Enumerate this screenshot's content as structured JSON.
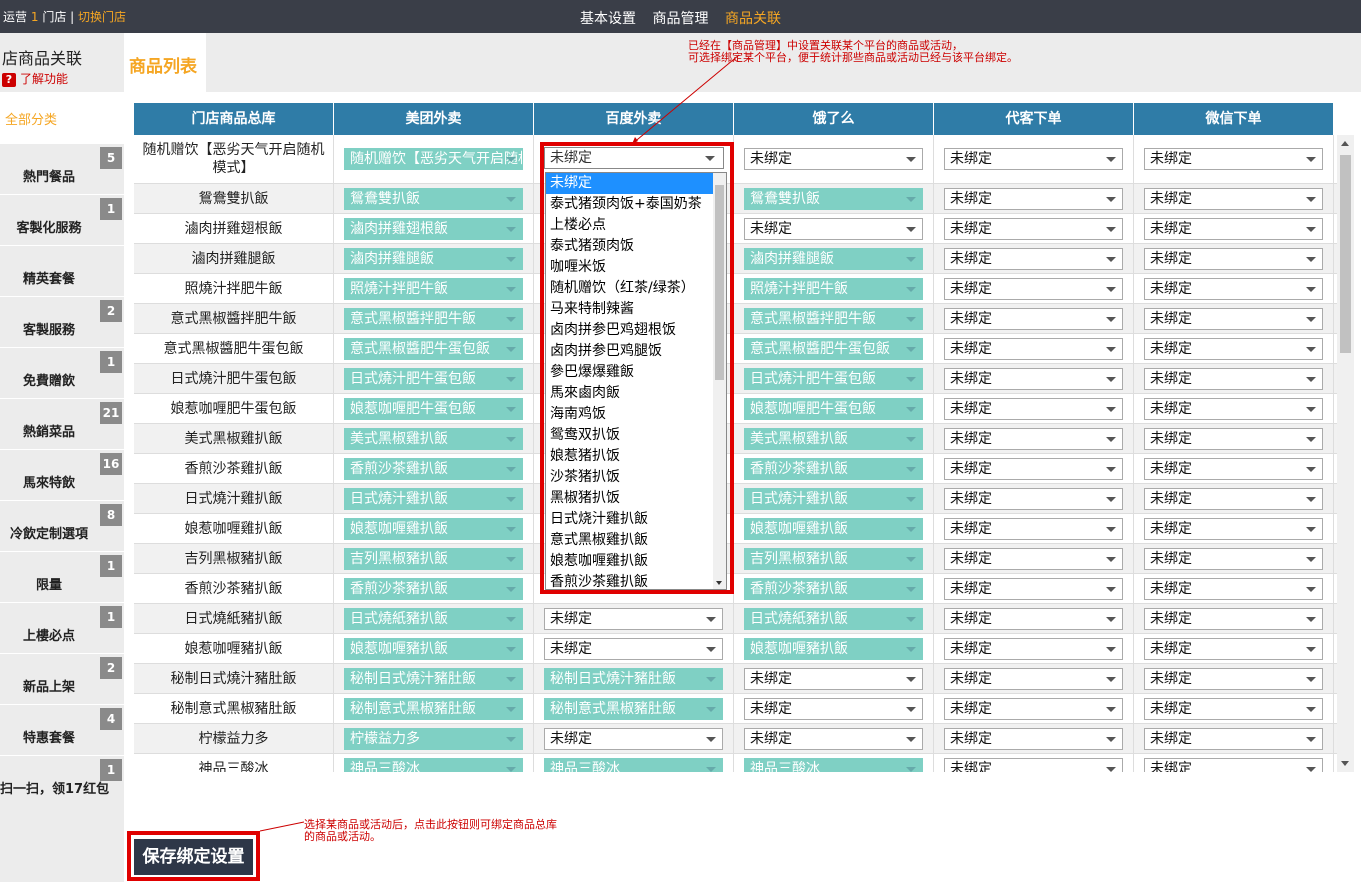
{
  "topbar": {
    "store_prefix": "运营",
    "store_count": "1",
    "store_suffix": "门店 |",
    "switch_label": "切换门店",
    "nav": [
      "基本设置",
      "商品管理",
      "商品关联"
    ],
    "active_nav": "商品关联"
  },
  "sidebar": {
    "title": "店商品关联",
    "help": "了解功能",
    "all_label": "全部分类",
    "items": [
      {
        "label": "熱門餐品",
        "count": "5"
      },
      {
        "label": "客製化服務",
        "count": "1"
      },
      {
        "label": "精英套餐",
        "count": ""
      },
      {
        "label": "客製服務",
        "count": "2"
      },
      {
        "label": "免費贈飲",
        "count": "1"
      },
      {
        "label": "熱銷菜品",
        "count": "21"
      },
      {
        "label": "馬來特飲",
        "count": "16"
      },
      {
        "label": "冷飲定制選項",
        "count": "8"
      },
      {
        "label": "限量",
        "count": "1"
      },
      {
        "label": "上樓必点",
        "count": "1"
      },
      {
        "label": "新品上架",
        "count": "2"
      },
      {
        "label": "特惠套餐",
        "count": "4"
      },
      {
        "label": "扫一扫，领17红包",
        "count": "1"
      }
    ]
  },
  "main": {
    "tab_title": "商品列表",
    "annotation_top": [
      "已经在【商品管理】中设置关联某个平台的商品或活动，",
      "可选择绑定某个平台，便于统计那些商品或活动已经与该平台绑定。"
    ],
    "annotation_bottom": [
      "选择某商品或活动后，点击此按钮则可绑定商品总库",
      "的商品或活动。"
    ],
    "save_label": "保存绑定设置"
  },
  "table": {
    "columns": [
      "门店商品总库",
      "美团外卖",
      "百度外卖",
      "饿了么",
      "代客下单",
      "微信下单"
    ],
    "unbound_label": "未绑定",
    "rows": [
      {
        "name": "随机赠饮【恶劣天气开启随机模式】",
        "cells": [
          "随机赠饮【恶劣天气开启随机模式】",
          "未绑定",
          "未绑定",
          "未绑定",
          "未绑定"
        ]
      },
      {
        "name": "鴛鴦雙扒飯",
        "cells": [
          "鴛鴦雙扒飯",
          "",
          "鴛鴦雙扒飯",
          "未绑定",
          "未绑定"
        ]
      },
      {
        "name": "滷肉拼雞翅根飯",
        "cells": [
          "滷肉拼雞翅根飯",
          "",
          "未绑定",
          "未绑定",
          "未绑定"
        ]
      },
      {
        "name": "滷肉拼雞腿飯",
        "cells": [
          "滷肉拼雞腿飯",
          "",
          "滷肉拼雞腿飯",
          "未绑定",
          "未绑定"
        ]
      },
      {
        "name": "照燒汁拌肥牛飯",
        "cells": [
          "照燒汁拌肥牛飯",
          "",
          "照燒汁拌肥牛飯",
          "未绑定",
          "未绑定"
        ]
      },
      {
        "name": "意式黑椒醬拌肥牛飯",
        "cells": [
          "意式黑椒醬拌肥牛飯",
          "",
          "意式黑椒醬拌肥牛飯",
          "未绑定",
          "未绑定"
        ]
      },
      {
        "name": "意式黑椒醬肥牛蛋包飯",
        "cells": [
          "意式黑椒醬肥牛蛋包飯",
          "",
          "意式黑椒醬肥牛蛋包飯",
          "未绑定",
          "未绑定"
        ]
      },
      {
        "name": "日式燒汁肥牛蛋包飯",
        "cells": [
          "日式燒汁肥牛蛋包飯",
          "",
          "日式燒汁肥牛蛋包飯",
          "未绑定",
          "未绑定"
        ]
      },
      {
        "name": "娘惹咖喱肥牛蛋包飯",
        "cells": [
          "娘惹咖喱肥牛蛋包飯",
          "",
          "娘惹咖喱肥牛蛋包飯",
          "未绑定",
          "未绑定"
        ]
      },
      {
        "name": "美式黑椒雞扒飯",
        "cells": [
          "美式黑椒雞扒飯",
          "",
          "美式黑椒雞扒飯",
          "未绑定",
          "未绑定"
        ]
      },
      {
        "name": "香煎沙茶雞扒飯",
        "cells": [
          "香煎沙茶雞扒飯",
          "",
          "香煎沙茶雞扒飯",
          "未绑定",
          "未绑定"
        ]
      },
      {
        "name": "日式燒汁雞扒飯",
        "cells": [
          "日式燒汁雞扒飯",
          "",
          "日式燒汁雞扒飯",
          "未绑定",
          "未绑定"
        ]
      },
      {
        "name": "娘惹咖喱雞扒飯",
        "cells": [
          "娘惹咖喱雞扒飯",
          "",
          "娘惹咖喱雞扒飯",
          "未绑定",
          "未绑定"
        ]
      },
      {
        "name": "吉列黑椒豬扒飯",
        "cells": [
          "吉列黑椒豬扒飯",
          "",
          "吉列黑椒豬扒飯",
          "未绑定",
          "未绑定"
        ]
      },
      {
        "name": "香煎沙茶豬扒飯",
        "cells": [
          "香煎沙茶豬扒飯",
          "",
          "香煎沙茶豬扒飯",
          "未绑定",
          "未绑定"
        ]
      },
      {
        "name": "日式燒紙豬扒飯",
        "cells": [
          "日式燒紙豬扒飯",
          "未绑定",
          "日式燒紙豬扒飯",
          "未绑定",
          "未绑定"
        ]
      },
      {
        "name": "娘惹咖喱豬扒飯",
        "cells": [
          "娘惹咖喱豬扒飯",
          "未绑定",
          "娘惹咖喱豬扒飯",
          "未绑定",
          "未绑定"
        ]
      },
      {
        "name": "秘制日式燒汁豬肚飯",
        "cells": [
          "秘制日式燒汁豬肚飯",
          "秘制日式燒汁豬肚飯",
          "未绑定",
          "未绑定",
          "未绑定"
        ]
      },
      {
        "name": "秘制意式黑椒豬肚飯",
        "cells": [
          "秘制意式黑椒豬肚飯",
          "秘制意式黑椒豬肚飯",
          "未绑定",
          "未绑定",
          "未绑定"
        ]
      },
      {
        "name": "柠檬益力多",
        "cells": [
          "柠檬益力多",
          "未绑定",
          "未绑定",
          "未绑定",
          "未绑定"
        ]
      },
      {
        "name": "神品三酸冰",
        "cells": [
          "神品三酸冰",
          "神品三酸冰",
          "神品三酸冰",
          "未绑定",
          "未绑定"
        ]
      }
    ]
  },
  "dropdown": {
    "current": "未绑定",
    "options": [
      "未绑定",
      "泰式猪颈肉饭+泰国奶茶",
      "上楼必点",
      "泰式猪颈肉饭",
      "咖喱米饭",
      "随机赠饮（红茶/绿茶）",
      "马来特制辣酱",
      "卤肉拼参巴鸡翅根饭",
      "卤肉拼参巴鸡腿饭",
      "參巴爆爆雞飯",
      "馬來鹵肉飯",
      "海南鸡饭",
      "鸳鸯双扒饭",
      "娘惹猪扒饭",
      "沙茶猪扒饭",
      "黑椒猪扒饭",
      "日式烧汁雞扒飯",
      "意式黑椒雞扒飯",
      "娘惹咖喱雞扒飯",
      "香煎沙茶雞扒飯"
    ]
  },
  "colors": {
    "topbar": "#3a3e48",
    "accent": "#f5a623",
    "header_blue": "#2f7ca7",
    "bound_teal": "#7fd0c4",
    "highlight_red": "#e00000"
  }
}
